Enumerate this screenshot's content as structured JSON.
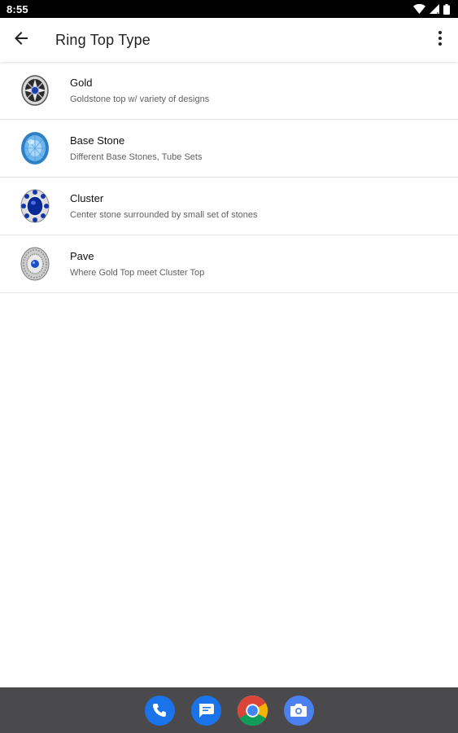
{
  "status_bar": {
    "time": "8:55",
    "icons": [
      "wifi-icon",
      "signal-icon",
      "battery-icon"
    ]
  },
  "app_bar": {
    "title": "Ring Top Type",
    "back_icon": "arrow-back-icon",
    "menu_icon": "more-vert-icon"
  },
  "list": {
    "items": [
      {
        "title": "Gold",
        "subtitle": "Goldstone top w/ variety of designs",
        "icon": "gold-ring-top-icon"
      },
      {
        "title": "Base Stone",
        "subtitle": "Different Base Stones, Tube Sets",
        "icon": "base-stone-icon"
      },
      {
        "title": "Cluster",
        "subtitle": "Center stone surrounded by small set of stones",
        "icon": "cluster-stone-icon"
      },
      {
        "title": "Pave",
        "subtitle": "Where Gold Top meet Cluster Top",
        "icon": "pave-stone-icon"
      }
    ]
  },
  "dock": {
    "apps": [
      "phone-app-icon",
      "messages-app-icon",
      "chrome-app-icon",
      "camera-app-icon"
    ]
  },
  "colors": {
    "accent_blue": "#1a73e8",
    "dock_bg": "#4a4a4d",
    "status_bg": "#000000"
  }
}
